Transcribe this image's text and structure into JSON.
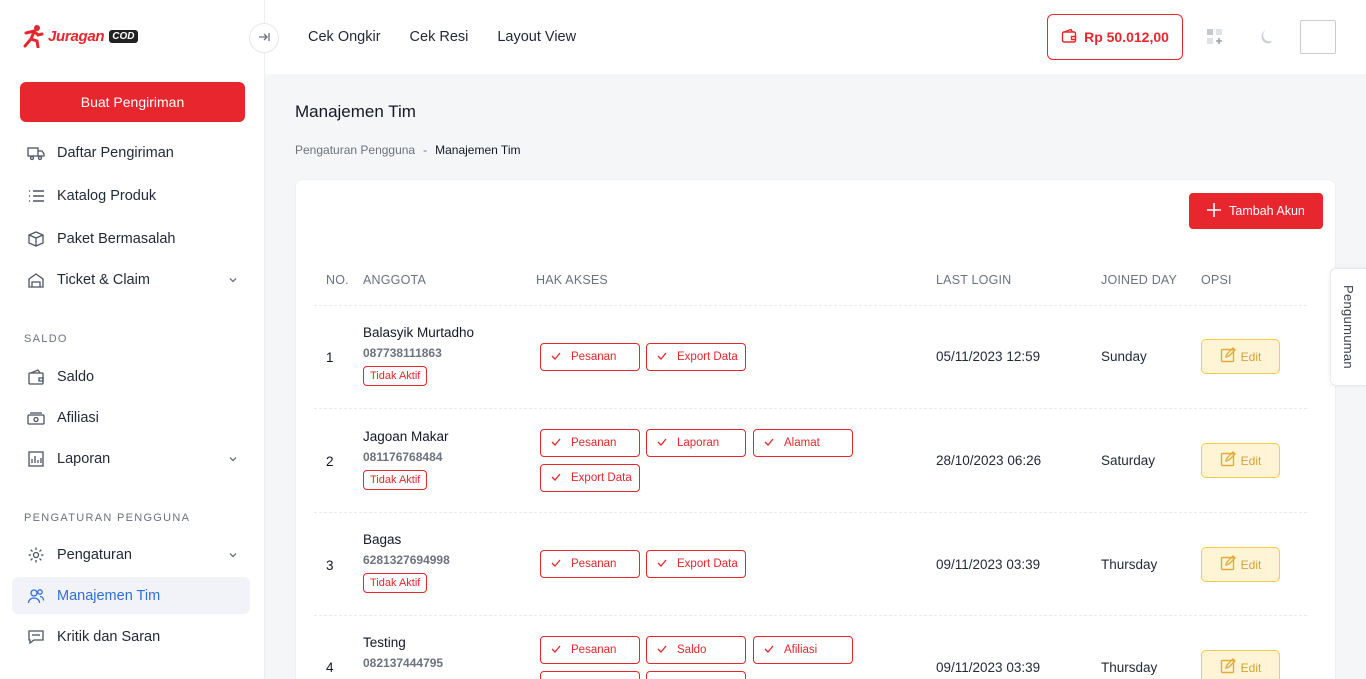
{
  "brand": {
    "name": "Juragan",
    "suffix": "COD",
    "color": "#e7262d"
  },
  "sidebar": {
    "create_button": "Buat Pengiriman",
    "partial_item": "Daftar Pengiriman",
    "items_top": [
      {
        "label": "Katalog Produk",
        "icon": "list-icon"
      },
      {
        "label": "Paket Bermasalah",
        "icon": "box-icon"
      },
      {
        "label": "Ticket & Claim",
        "icon": "ticket-icon"
      }
    ],
    "section_saldo": "SALDO",
    "items_saldo": [
      {
        "label": "Saldo",
        "icon": "wallet-icon"
      },
      {
        "label": "Afiliasi",
        "icon": "money-icon"
      },
      {
        "label": "Laporan",
        "icon": "report-icon"
      }
    ],
    "section_users": "PENGATURAN PENGGUNA",
    "items_users": [
      {
        "label": "Pengaturan",
        "icon": "gear-icon"
      },
      {
        "label": "Manajemen Tim",
        "icon": "users-icon"
      },
      {
        "label": "Kritik dan Saran",
        "icon": "message-icon"
      }
    ]
  },
  "topbar": {
    "nav": [
      "Cek Ongkir",
      "Cek Resi",
      "Layout View"
    ],
    "balance": "Rp 50.012,00"
  },
  "page": {
    "title": "Manajemen Tim",
    "breadcrumb_parent": "Pengaturan Pengguna",
    "breadcrumb_sep": "-",
    "breadcrumb_current": "Manajemen Tim",
    "add_button": "Tambah Akun"
  },
  "table": {
    "headers": [
      "NO.",
      "ANGGOTA",
      "HAK AKSES",
      "LAST LOGIN",
      "JOINED DAY",
      "OPSI"
    ],
    "edit_label": "Edit",
    "rows": [
      {
        "no": "1",
        "name": "Balasyik Murtadho",
        "phone": "087738111863",
        "status": "Tidak Aktif",
        "access": [
          "Pesanan",
          "Export Data"
        ],
        "last_login": "05/11/2023 12:59",
        "joined": "Sunday"
      },
      {
        "no": "2",
        "name": "Jagoan Makar",
        "phone": "081176768484",
        "status": "Tidak Aktif",
        "access": [
          "Pesanan",
          "Laporan",
          "Alamat",
          "Export Data"
        ],
        "last_login": "28/10/2023 06:26",
        "joined": "Saturday"
      },
      {
        "no": "3",
        "name": "Bagas",
        "phone": "6281327694998",
        "status": "Tidak Aktif",
        "access": [
          "Pesanan",
          "Export Data"
        ],
        "last_login": "09/11/2023 03:39",
        "joined": "Thursday"
      },
      {
        "no": "4",
        "name": "Testing",
        "phone": "082137444795",
        "status": "",
        "access": [
          "Pesanan",
          "Saldo",
          "Afiliasi"
        ],
        "last_login": "09/11/2023 03:39",
        "joined": "Thursday"
      }
    ]
  },
  "announcement_tab": "Pengumuman"
}
